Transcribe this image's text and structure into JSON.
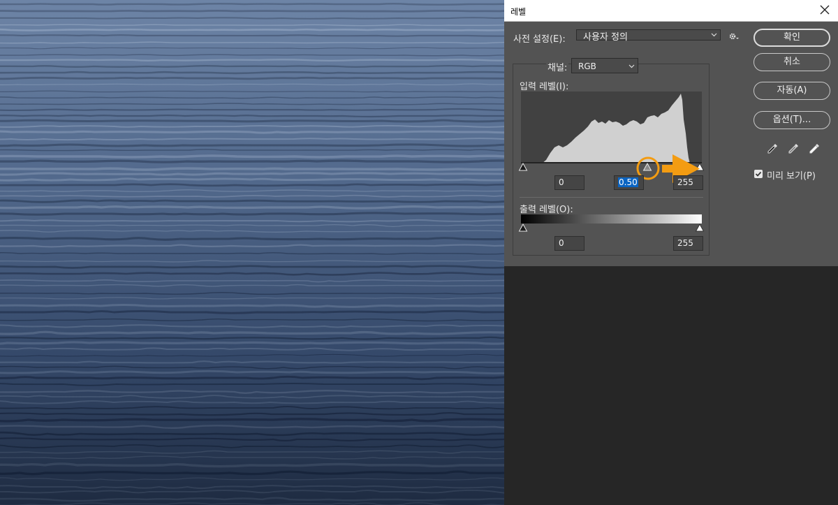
{
  "dialog": {
    "title": "레벨",
    "preset_label": "사전 설정(E):",
    "preset_value": "사용자 정의",
    "channel_label": "채널:",
    "channel_value": "RGB",
    "input_levels_label": "입력 레벨(I):",
    "input_black": "0",
    "input_gamma": "0.50",
    "input_white": "255",
    "output_levels_label": "출력 레벨(O):",
    "output_black": "0",
    "output_white": "255",
    "buttons": {
      "ok": "확인",
      "cancel": "취소",
      "auto": "자동(A)",
      "options": "옵션(T)..."
    },
    "preview_label": "미리 보기(P)",
    "preview_checked": true
  },
  "colors": {
    "dialog_bg": "#535353",
    "annotation_orange": "#f39c12",
    "selection_blue": "#0a64c2",
    "histogram_fill": "#d0d0d0"
  },
  "icons": [
    "close-icon",
    "gear-icon",
    "chevron-down-icon",
    "black-point-eyedropper-icon",
    "gray-point-eyedropper-icon",
    "white-point-eyedropper-icon",
    "checkmark-icon",
    "arrow-right-icon"
  ]
}
